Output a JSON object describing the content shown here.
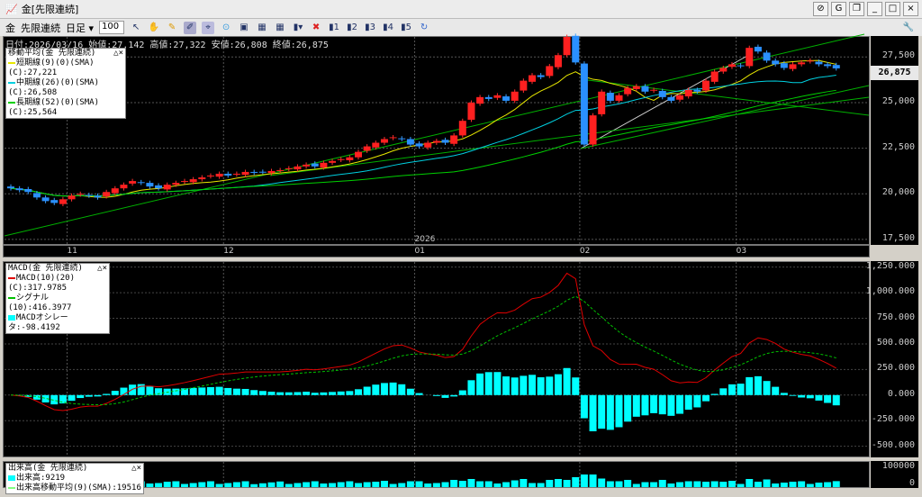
{
  "window": {
    "title": "金[先限連続]"
  },
  "toolbar": {
    "symbol": "金",
    "contract": "先限連続",
    "period": "日足",
    "bars": "100"
  },
  "info": "日付:2026/03/16 始値:27,142 高値:27,322 安値:26,808 終値:26,875",
  "ma_legend": {
    "title": "移動平均(金 先限連続)",
    "items": [
      {
        "label": "短期線(9)(0)(SMA)(C):27,221",
        "color": "#e8e800"
      },
      {
        "label": "中期線(26)(0)(SMA)(C):26,508",
        "color": "#00d0e0"
      },
      {
        "label": "長期線(52)(0)(SMA)(C):25,564",
        "color": "#00d000"
      }
    ]
  },
  "macd_legend": {
    "title": "MACD(金 先限連続)",
    "items": [
      {
        "label": "MACD(10)(20)(C):317.9785",
        "color": "#e00000"
      },
      {
        "label": "シグナル(10):416.3977",
        "color": "#00c000"
      },
      {
        "label": "MACDオシレータ:-98.4192",
        "color": "#00ffff"
      }
    ]
  },
  "vol_legend": {
    "title": "出来高(金 先限連続)",
    "items": [
      {
        "label": "出来高:9219",
        "color": "#00ffff"
      },
      {
        "label": "出来高移動平均(9)(SMA):19516",
        "color": "#80ff80"
      }
    ]
  },
  "current_price": "26,875",
  "chart_data": {
    "type": "candlestick",
    "price_ticks": [
      "27,500",
      "25,000",
      "22,500",
      "20,000",
      "17,500"
    ],
    "price_range": [
      17200,
      28550
    ],
    "macd_ticks": [
      "1,250.000",
      "1,000.000",
      "750.000",
      "500.000",
      "250.000",
      "0.000",
      "-250.000",
      "-500.000"
    ],
    "macd_range": [
      -600,
      1300
    ],
    "volume_ticks": [
      "100000",
      "0"
    ],
    "x_labels": [
      {
        "label": "11",
        "bar": 7
      },
      {
        "label": "12",
        "bar": 25
      },
      {
        "label": "2026",
        "bar": 47
      },
      {
        "label": "01",
        "bar": 47
      },
      {
        "label": "02",
        "bar": 66
      },
      {
        "label": "03",
        "bar": 84
      }
    ],
    "closes": [
      20300,
      20200,
      20100,
      19800,
      19600,
      19500,
      19700,
      19900,
      20000,
      19900,
      19800,
      20100,
      20300,
      20500,
      20700,
      20600,
      20400,
      20300,
      20500,
      20600,
      20700,
      20800,
      20900,
      21000,
      21100,
      21000,
      21100,
      21200,
      21150,
      21200,
      21250,
      21300,
      21400,
      21500,
      21600,
      21500,
      21700,
      21800,
      21900,
      22000,
      22300,
      22600,
      22800,
      23000,
      23100,
      23000,
      22700,
      22600,
      22800,
      22900,
      22800,
      23200,
      24000,
      25000,
      25300,
      25200,
      25400,
      25100,
      25600,
      26200,
      26500,
      26400,
      27000,
      27600,
      28600,
      27200,
      22700,
      24300,
      25600,
      25100,
      25400,
      25800,
      25900,
      25600,
      25700,
      25300,
      25100,
      25400,
      25700,
      25600,
      26200,
      26700,
      26900,
      27100,
      27000,
      28000,
      27800,
      27300,
      27100,
      26900,
      27100,
      27200,
      27300,
      27100,
      27000,
      26875
    ]
  }
}
